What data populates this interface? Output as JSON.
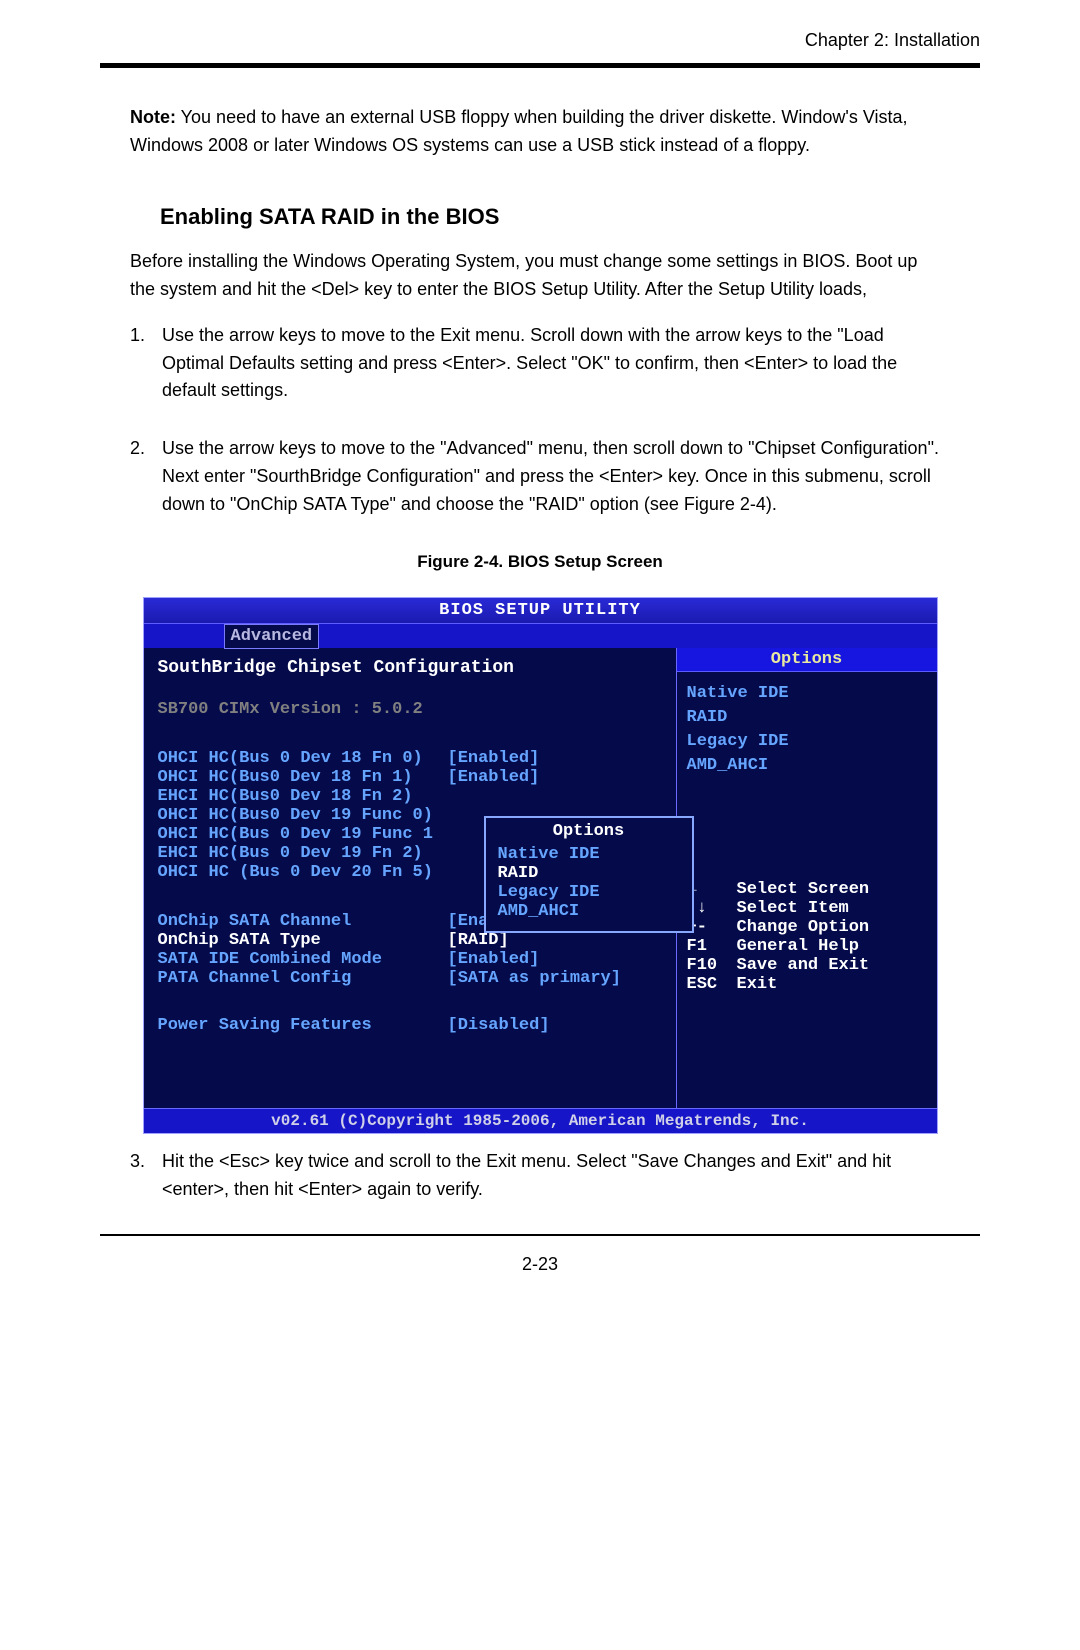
{
  "header": {
    "chapter": "Chapter 2: Installation"
  },
  "note": {
    "label": "Note:",
    "text": " You need to have an external USB floppy when building the driver diskette. Window's Vista, Windows 2008 or later Windows OS systems can use a USB stick instead of a floppy."
  },
  "section": {
    "title": "Enabling SATA RAID in the BIOS",
    "intro": "Before installing the Windows Operating System, you must change some settings in BIOS. Boot up the system and hit the <Del> key to enter the BIOS Setup Utility. After the Setup Utility loads,"
  },
  "steps": {
    "s1": "Use the arrow keys to move to the Exit menu. Scroll down with the arrow keys to the \"Load Optimal Defaults setting and press <Enter>. Select \"OK\" to confirm, then <Enter> to load the default settings.",
    "s2": "Use the arrow keys to move to the \"Advanced\" menu, then scroll down to \"Chipset Configuration\". Next enter \"SourthBridge Configuration\" and press the <Enter> key. Once in this submenu, scroll down to \"OnChip SATA Type\" and choose the \"RAID\" option (see Figure 2-4).",
    "s3": "Hit the <Esc> key twice and scroll to the Exit menu. Select \"Save Changes and Exit\" and hit <enter>, then hit <Enter> again to verify."
  },
  "figure_caption": "Figure 2-4. BIOS Setup Screen",
  "bios": {
    "title": "BIOS SETUP UTILITY",
    "tab": "Advanced",
    "subtitle": "SouthBridge Chipset Configuration",
    "version": "SB700 CIMx Version : 5.0.2",
    "items": {
      "i0": {
        "label": "OHCI HC(Bus 0 Dev 18 Fn 0)",
        "value": "[Enabled]"
      },
      "i1": {
        "label": "OHCI HC(Bus0 Dev 18 Fn 1)",
        "value": "[Enabled]"
      },
      "i2": {
        "label": "EHCI HC(Bus0 Dev 18 Fn 2)",
        "value": ""
      },
      "i3": {
        "label": "OHCI HC(Bus0 Dev 19 Func 0)",
        "value": ""
      },
      "i4": {
        "label": "OHCI HC(Bus 0 Dev 19 Func 1",
        "value": ""
      },
      "i5": {
        "label": "EHCI HC(Bus 0 Dev 19 Fn 2)",
        "value": ""
      },
      "i6": {
        "label": "OHCI HC (Bus 0 Dev 20 Fn 5)",
        "value": ""
      }
    },
    "group2": {
      "g0": {
        "label": "OnChip SATA Channel",
        "value": "[Enabled]"
      },
      "g1": {
        "label": "OnChip SATA Type",
        "value": "[RAID]"
      },
      "g2": {
        "label": "SATA IDE Combined Mode",
        "value": "[Enabled]"
      },
      "g3": {
        "label": "PATA Channel Config",
        "value": "[SATA as primary]"
      }
    },
    "group3": {
      "p0": {
        "label": "Power Saving Features",
        "value": "[Disabled]"
      }
    },
    "popup": {
      "title": "Options",
      "o0": "Native IDE",
      "o1": "RAID",
      "o2": "Legacy IDE",
      "o3": "AMD_AHCI"
    },
    "right": {
      "options_header": "Options",
      "o0": "Native IDE",
      "o1": "RAID",
      "o2": "Legacy IDE",
      "o3": "AMD_AHCI"
    },
    "nav": {
      "n0": {
        "key": "←",
        "act": "Select Screen"
      },
      "n1": {
        "key": "↑↓",
        "act": "Select Item"
      },
      "n2": {
        "key": "+-",
        "act": "Change Option"
      },
      "n3": {
        "key": "F1",
        "act": "General Help"
      },
      "n4": {
        "key": "F10",
        "act": "Save and Exit"
      },
      "n5": {
        "key": "ESC",
        "act": "Exit"
      }
    },
    "footer": "v02.61 (C)Copyright 1985-2006, American Megatrends, Inc."
  },
  "page_number": "2-23"
}
